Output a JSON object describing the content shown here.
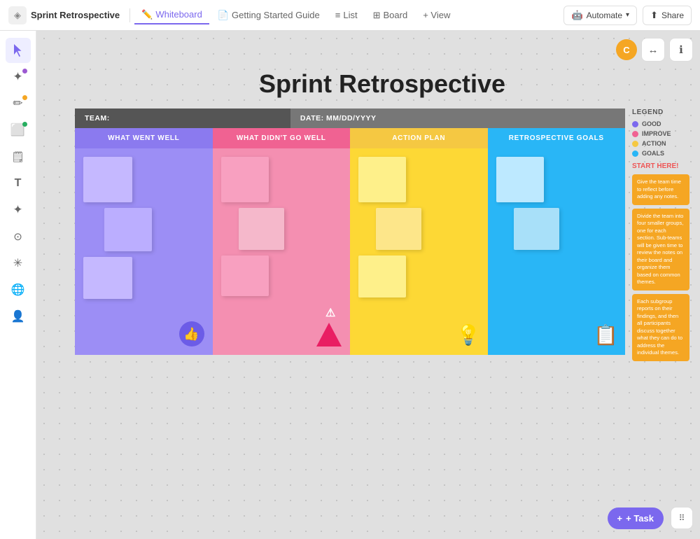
{
  "app": {
    "title": "Sprint Retrospective"
  },
  "nav": {
    "logo_icon": "◈",
    "project_name": "Sprint Retrospective",
    "tabs": [
      {
        "id": "whiteboard",
        "label": "Whiteboard",
        "icon": "✏️",
        "active": true
      },
      {
        "id": "getting-started",
        "label": "Getting Started Guide",
        "icon": "📄"
      },
      {
        "id": "list",
        "label": "List",
        "icon": "≡"
      },
      {
        "id": "board",
        "label": "Board",
        "icon": "⊞"
      },
      {
        "id": "view",
        "label": "+ View",
        "icon": ""
      }
    ],
    "automate_label": "Automate",
    "share_label": "Share",
    "avatar_initials": "C"
  },
  "sidebar": {
    "items": [
      {
        "id": "cursor",
        "icon": "↖",
        "active": true,
        "dot": null
      },
      {
        "id": "pen-sparkle",
        "icon": "✦",
        "active": false,
        "dot": "purple"
      },
      {
        "id": "pencil",
        "icon": "✏",
        "active": false,
        "dot": "orange"
      },
      {
        "id": "shapes",
        "icon": "⬜",
        "active": false,
        "dot": "green"
      },
      {
        "id": "sticky",
        "icon": "🗒",
        "active": false,
        "dot": null
      },
      {
        "id": "text",
        "icon": "T",
        "active": false,
        "dot": null
      },
      {
        "id": "sparkle",
        "icon": "✦",
        "active": false,
        "dot": null
      },
      {
        "id": "nodes",
        "icon": "⊙",
        "active": false,
        "dot": null
      },
      {
        "id": "sparkles2",
        "icon": "✳",
        "active": false,
        "dot": null
      },
      {
        "id": "globe",
        "icon": "🌐",
        "active": false,
        "dot": null
      },
      {
        "id": "person",
        "icon": "👤",
        "active": false,
        "dot": null
      }
    ]
  },
  "board": {
    "title": "Sprint Retrospective",
    "meta_team_label": "TEAM:",
    "meta_date_label": "DATE: MM/DD/YYYY",
    "columns": [
      {
        "id": "what-went-well",
        "header": "WHAT WENT WELL",
        "color": "purple",
        "icon": "👍",
        "icon_type": "purple-icon"
      },
      {
        "id": "what-didnt-go-well",
        "header": "WHAT DIDN'T GO WELL",
        "color": "pink",
        "icon": "⚠",
        "icon_type": "pink-icon"
      },
      {
        "id": "action-plan",
        "header": "ACTION PLAN",
        "color": "yellow",
        "icon": "💡",
        "icon_type": "yellow-icon"
      },
      {
        "id": "retrospective-goals",
        "header": "RETROSPECTIVE GOALS",
        "color": "blue",
        "icon": "📋",
        "icon_type": "blue-icon"
      }
    ]
  },
  "legend": {
    "title": "LEGEND",
    "items": [
      {
        "id": "good",
        "label": "GOOD",
        "color": "#7b68ee"
      },
      {
        "id": "improve",
        "label": "IMPROVE",
        "color": "#f06292"
      },
      {
        "id": "action",
        "label": "ACTION",
        "color": "#f5c842"
      },
      {
        "id": "goals",
        "label": "GOALS",
        "color": "#29b6f6"
      }
    ],
    "start_here": "START HERE!",
    "instructions": [
      "Give the team time to reflect before adding any notes.",
      "Divide the team into four smaller groups, one for each section. Sub-teams will be given time to review the notes on their board and organize them based on common themes.",
      "Each subgroup reports on their findings, and then all participants discuss together what they can do to address the individual themes."
    ]
  },
  "toolbar": {
    "task_label": "+ Task",
    "grid_icon": "⋮⋮"
  }
}
